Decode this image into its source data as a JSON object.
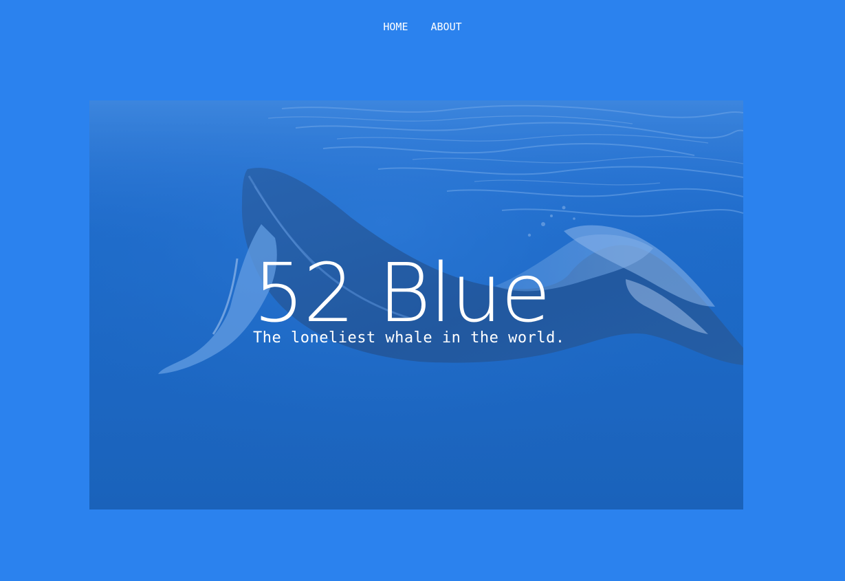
{
  "nav": {
    "items": [
      {
        "label": "HOME"
      },
      {
        "label": "ABOUT"
      }
    ]
  },
  "hero": {
    "title": "52 Blue",
    "subtitle": "The loneliest whale in the world.",
    "image_subject": "humpback-whale-underwater"
  },
  "colors": {
    "page_background": "#2b82ee",
    "hero_tint": "#1a65bf",
    "text": "#ffffff"
  }
}
